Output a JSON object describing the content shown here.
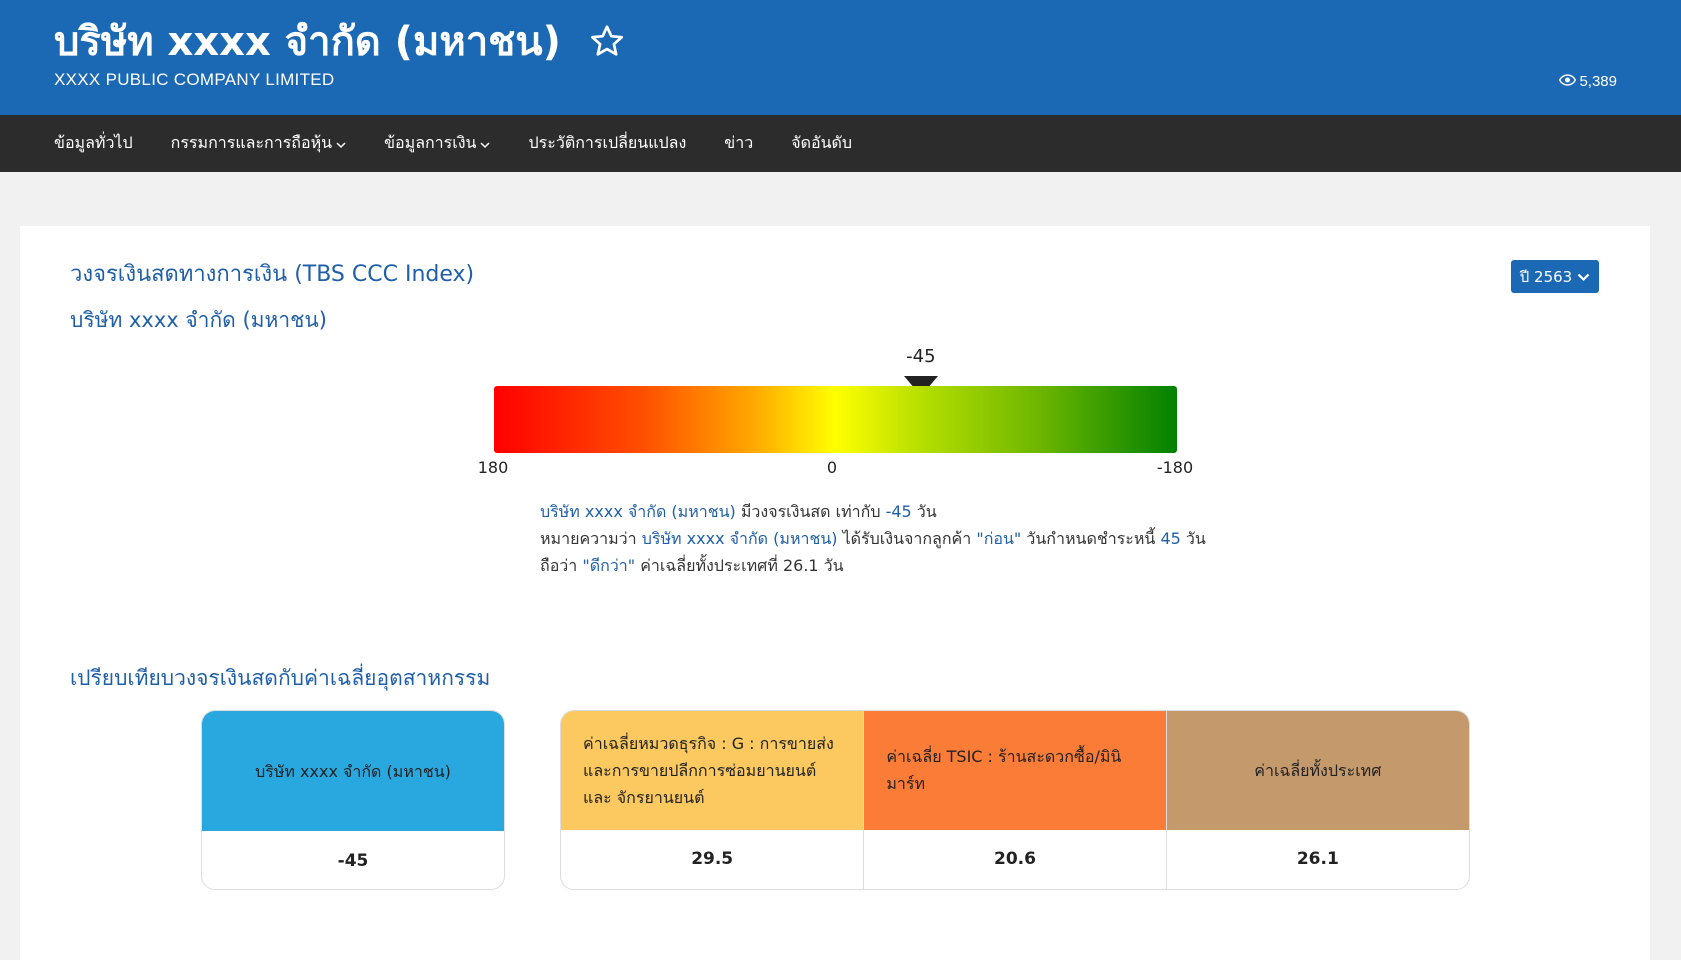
{
  "header": {
    "title": "บริษัท xxxx จำกัด (มหาชน)",
    "title_en": "XXXX PUBLIC COMPANY LIMITED",
    "views": "5,389",
    "star_icon": "star-outline-icon",
    "eye_icon": "eye-icon"
  },
  "nav": {
    "items": [
      {
        "label": "ข้อมูลทั่วไป",
        "has_dropdown": false
      },
      {
        "label": "กรรมการและการถือหุ้น",
        "has_dropdown": true
      },
      {
        "label": "ข้อมูลการเงิน",
        "has_dropdown": true
      },
      {
        "label": "ประวัติการเปลี่ยนแปลง",
        "has_dropdown": false
      },
      {
        "label": "ข่าว",
        "has_dropdown": false
      },
      {
        "label": "จัดอันดับ",
        "has_dropdown": false
      }
    ]
  },
  "main": {
    "section_title": "วงจรเงินสดทางการเงิน (TBS CCC Index)",
    "company_name": "บริษัท xxxx จำกัด (มหาชน)",
    "year_button": "ปี 2563"
  },
  "gauge": {
    "value": -45,
    "value_label": "-45",
    "min": 180,
    "max": -180,
    "ticks": [
      "180",
      "0",
      "-180"
    ],
    "colors": {
      "start": "#ff0000",
      "middle": "#ffff00",
      "end": "#018101"
    }
  },
  "description": {
    "line1": {
      "company": "บริษัท xxxx จำกัด (มหาชน)",
      "text1": " มีวงจรเงินสด เท่ากับ ",
      "value": "-45",
      "text2": " วัน"
    },
    "line2": {
      "text1": "หมายความว่า ",
      "company": "บริษัท xxxx จำกัด (มหาชน)",
      "text2": " ได้รับเงินจากลูกค้า ",
      "when": "\"ก่อน\"",
      "text3": " วันกำหนดชำระหนี้ ",
      "days": "45",
      "text4": " วัน"
    },
    "line3": {
      "text1": "ถือว่า ",
      "verdict": "\"ดีกว่า\"",
      "text2": " ค่าเฉลี่ยทั้งประเทศที่ 26.1 วัน"
    }
  },
  "comparison": {
    "title": "เปรียบเทียบวงจรเงินสดกับค่าเฉลี่ยอุตสาหกรรม",
    "company": {
      "label": "บริษัท xxxx จำกัด (มหาชน)",
      "value": "-45",
      "color": "#29a8e0"
    },
    "averages": [
      {
        "label": "ค่าเฉลี่ยหมวดธุรกิจ : G : การขายส่งและการขายปลีกการซ่อมยานยนต์ และ จักรยานยนต์",
        "value": "29.5",
        "color": "#fbc95f"
      },
      {
        "label": "ค่าเฉลี่ย TSIC : ร้านสะดวกซื้อ/มินิมาร์ท",
        "value": "20.6",
        "color": "#fb7c37"
      },
      {
        "label": "ค่าเฉลี่ยทั้งประเทศ",
        "value": "26.1",
        "color": "#c49a6c"
      }
    ]
  }
}
